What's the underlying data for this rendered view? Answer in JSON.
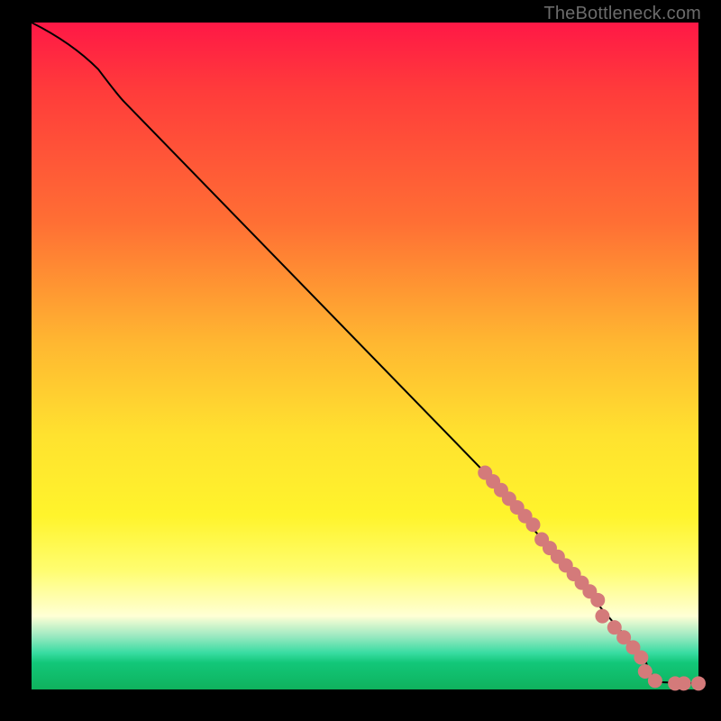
{
  "watermark": "TheBottleneck.com",
  "chart_data": {
    "type": "line",
    "title": "",
    "xlabel": "",
    "ylabel": "",
    "xlim": [
      0,
      100
    ],
    "ylim": [
      0,
      100
    ],
    "curve": [
      {
        "x": 0,
        "y": 100
      },
      {
        "x": 3,
        "y": 98.5
      },
      {
        "x": 6,
        "y": 96.5
      },
      {
        "x": 10,
        "y": 93
      },
      {
        "x": 14,
        "y": 88
      },
      {
        "x": 68,
        "y": 32.5
      },
      {
        "x": 92,
        "y": 4.5
      },
      {
        "x": 92.5,
        "y": 2.5
      },
      {
        "x": 93.5,
        "y": 1.4
      },
      {
        "x": 95,
        "y": 0.9
      },
      {
        "x": 100,
        "y": 0.9
      }
    ],
    "markers": [
      {
        "x": 68.0,
        "y": 32.5
      },
      {
        "x": 69.2,
        "y": 31.2
      },
      {
        "x": 70.4,
        "y": 29.9
      },
      {
        "x": 71.6,
        "y": 28.6
      },
      {
        "x": 72.8,
        "y": 27.3
      },
      {
        "x": 74.0,
        "y": 26.0
      },
      {
        "x": 75.2,
        "y": 24.7
      },
      {
        "x": 76.5,
        "y": 22.5
      },
      {
        "x": 77.7,
        "y": 21.2
      },
      {
        "x": 78.9,
        "y": 19.9
      },
      {
        "x": 80.1,
        "y": 18.6
      },
      {
        "x": 81.3,
        "y": 17.3
      },
      {
        "x": 82.5,
        "y": 16.0
      },
      {
        "x": 83.7,
        "y": 14.7
      },
      {
        "x": 84.9,
        "y": 13.4
      },
      {
        "x": 85.6,
        "y": 11.0
      },
      {
        "x": 87.4,
        "y": 9.3
      },
      {
        "x": 88.8,
        "y": 7.8
      },
      {
        "x": 90.2,
        "y": 6.3
      },
      {
        "x": 91.4,
        "y": 4.8
      },
      {
        "x": 92.0,
        "y": 2.7
      },
      {
        "x": 93.5,
        "y": 1.3
      },
      {
        "x": 96.5,
        "y": 0.9
      },
      {
        "x": 97.8,
        "y": 0.9
      },
      {
        "x": 100.0,
        "y": 0.9
      }
    ],
    "marker_radius": 8,
    "gradient_stops": [
      {
        "pct": 0,
        "color": "#ff1846"
      },
      {
        "pct": 30,
        "color": "#ff6f34"
      },
      {
        "pct": 62,
        "color": "#ffe22f"
      },
      {
        "pct": 89,
        "color": "#ffffd5"
      },
      {
        "pct": 96,
        "color": "#12c779"
      },
      {
        "pct": 100,
        "color": "#0fb25d"
      }
    ]
  }
}
